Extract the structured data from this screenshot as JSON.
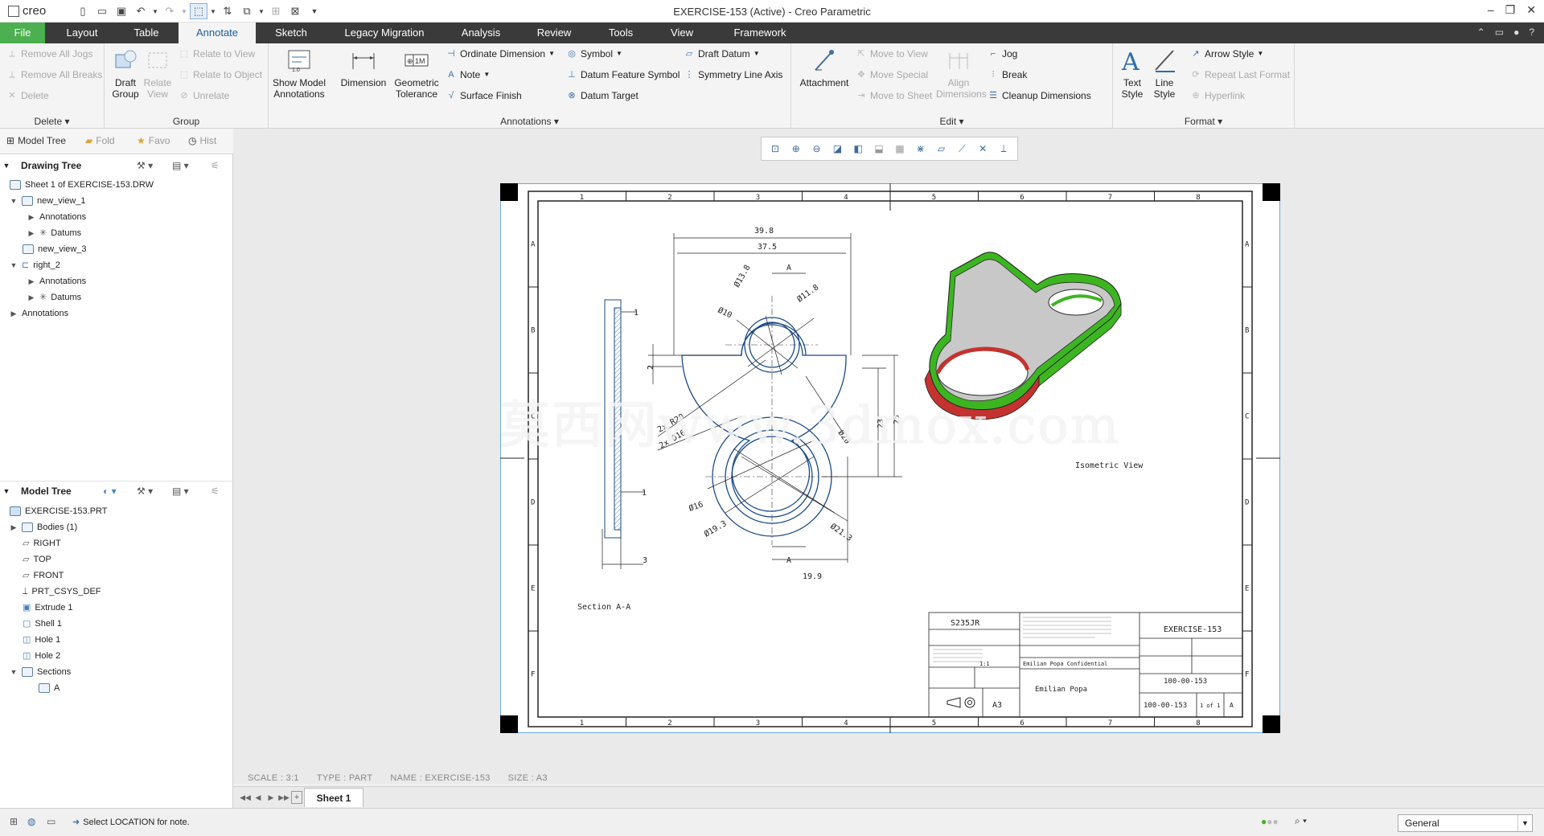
{
  "app": {
    "logo": "creo",
    "window_title": "EXERCISE-153 (Active) - Creo Parametric"
  },
  "tabs": [
    "File",
    "Layout",
    "Table",
    "Annotate",
    "Sketch",
    "Legacy Migration",
    "Analysis",
    "Review",
    "Tools",
    "View",
    "Framework"
  ],
  "active_tab": "Annotate",
  "ribbon": {
    "delete": {
      "items": [
        "Remove All Jogs",
        "Remove All Breaks",
        "Delete"
      ],
      "label": "Delete"
    },
    "group": {
      "draft_group": "Draft Group",
      "relate_view": "Relate View",
      "items": [
        "Relate to View",
        "Relate to Object",
        "Unrelate"
      ],
      "label": "Group"
    },
    "annotations": {
      "show_model": "Show Model Annotations",
      "dimension": "Dimension",
      "geometric_tolerance": "Geometric Tolerance",
      "col1": [
        "Ordinate Dimension",
        "Note",
        "Surface Finish"
      ],
      "col2": [
        "Symbol",
        "Datum Feature Symbol",
        "Datum Target"
      ],
      "col3": [
        "Draft Datum",
        "Symmetry Line Axis"
      ],
      "label": "Annotations"
    },
    "edit": {
      "attachment": "Attachment",
      "col1": [
        "Move to View",
        "Move Special",
        "Move to Sheet"
      ],
      "align": "Align Dimensions",
      "col2": [
        "Jog",
        "Break",
        "Cleanup Dimensions"
      ],
      "label": "Edit"
    },
    "format": {
      "text_style": "Text Style",
      "line_style": "Line Style",
      "items": [
        "Arrow Style",
        "Repeat Last Format",
        "Hyperlink"
      ],
      "label": "Format"
    }
  },
  "nav_tabs": [
    "Model Tree",
    "Fold",
    "Favo",
    "Hist"
  ],
  "drawing_tree": {
    "title": "Drawing Tree",
    "items": [
      "Sheet 1 of EXERCISE-153.DRW",
      "new_view_1",
      "Annotations",
      "Datums",
      "new_view_3",
      "right_2",
      "Annotations",
      "Datums",
      "Annotations"
    ]
  },
  "model_tree": {
    "title": "Model Tree",
    "items": [
      "EXERCISE-153.PRT",
      "Bodies (1)",
      "RIGHT",
      "TOP",
      "FRONT",
      "PRT_CSYS_DEF",
      "Extrude 1",
      "Shell 1",
      "Hole 1",
      "Hole 2",
      "Sections",
      "A"
    ]
  },
  "drawing": {
    "border_cols": [
      "1",
      "2",
      "3",
      "4",
      "5",
      "6",
      "7",
      "8"
    ],
    "border_rows": [
      "A",
      "B",
      "C",
      "D",
      "E",
      "F"
    ],
    "dims": [
      "39.8",
      "37.5",
      "A",
      "Ø13.8",
      "Ø11.8",
      "Ø10",
      "1",
      "2",
      "2x R20",
      "2x Ø16",
      "25",
      "23",
      "Ø20",
      "Ø16",
      "Ø19.3",
      "Ø21.3",
      "A",
      "19.9",
      "1",
      "3"
    ],
    "section_label": "Section A-A",
    "iso_label": "Isometric View",
    "title_block": {
      "material": "S235JR",
      "drawing_name": "EXERCISE-153",
      "drawing_number": "100-00-153",
      "drawing_number_2": "100-00-153",
      "company": "Emilian Popa Confidential",
      "author": "Emilian Popa",
      "size": "A3",
      "scale": "1:1",
      "sheet": "1 of 1",
      "revision": "A"
    }
  },
  "watermark": "莫西网www.3dmox.com",
  "infobar": {
    "scale": "SCALE : 3:1",
    "type": "TYPE : PART",
    "name": "NAME : EXERCISE-153",
    "size": "SIZE : A3"
  },
  "sheet_tab": "Sheet 1",
  "status": {
    "message": "Select LOCATION for note.",
    "filter": "General"
  },
  "colors": {
    "tabbar": "#3a3a3a",
    "file_tab": "#4caf50",
    "active_text": "#1a5ea8",
    "iso_green": "#3cb521",
    "iso_red": "#c4332f",
    "iso_face": "#c8c8c8"
  }
}
